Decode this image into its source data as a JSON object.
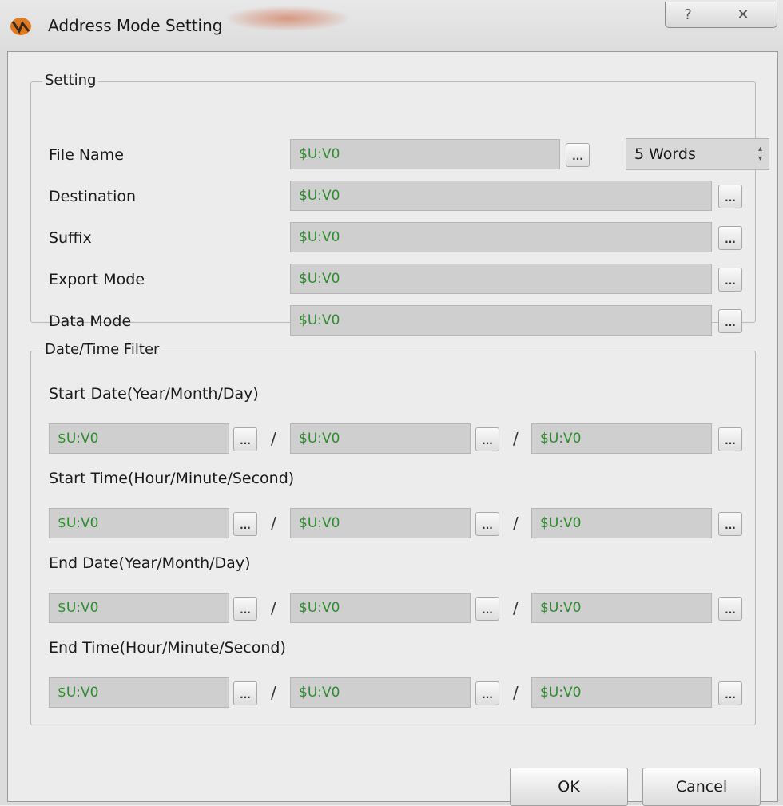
{
  "window": {
    "title": "Address Mode Setting",
    "help_glyph": "?",
    "close_glyph": "✕"
  },
  "setting": {
    "legend": "Setting",
    "rows": [
      {
        "label": "File Name",
        "value": "$U:V0"
      },
      {
        "label": "Destination",
        "value": "$U:V0"
      },
      {
        "label": "Suffix",
        "value": "$U:V0"
      },
      {
        "label": "Export Mode",
        "value": "$U:V0"
      },
      {
        "label": "Data Mode",
        "value": "$U:V0"
      }
    ],
    "length_spinner": {
      "value": "5 Words"
    },
    "browse_label": "..."
  },
  "filter": {
    "legend": "Date/Time Filter",
    "separator": "/",
    "groups": [
      {
        "label": "Start Date(Year/Month/Day)",
        "values": [
          "$U:V0",
          "$U:V0",
          "$U:V0"
        ]
      },
      {
        "label": "Start Time(Hour/Minute/Second)",
        "values": [
          "$U:V0",
          "$U:V0",
          "$U:V0"
        ]
      },
      {
        "label": "End Date(Year/Month/Day)",
        "values": [
          "$U:V0",
          "$U:V0",
          "$U:V0"
        ]
      },
      {
        "label": "End Time(Hour/Minute/Second)",
        "values": [
          "$U:V0",
          "$U:V0",
          "$U:V0"
        ]
      }
    ]
  },
  "buttons": {
    "ok": "OK",
    "cancel": "Cancel"
  },
  "colors": {
    "value_text": "#2e8b2e",
    "field_bg": "#cfcfcf",
    "dialog_bg": "#ececec"
  },
  "icons": {
    "app": "app-logo-icon",
    "help": "help-icon",
    "close": "close-icon",
    "browse": "ellipsis-icon",
    "spinner": "spinner-arrows-icon"
  }
}
